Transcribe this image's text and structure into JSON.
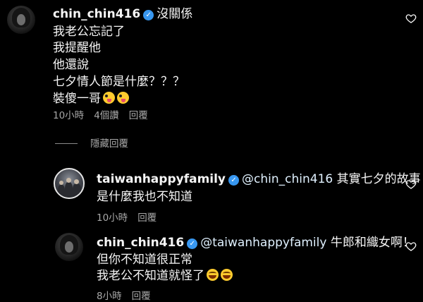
{
  "comments": [
    {
      "username": "chin_chin416",
      "lines": [
        "沒關係",
        "我老公忘記了",
        "我提醒他",
        "他還說",
        "七夕情人節是什麼？？？",
        "裝傻一哥"
      ],
      "emojis": [
        "zany-face-emoji",
        "zany-face-emoji"
      ],
      "time": "10小時",
      "likes": "4個讚",
      "reply": "回覆"
    },
    {
      "username": "taiwanhappyfamily",
      "mention": "@chin_chin416",
      "lines": [
        "其實七夕的故事",
        "是什麼我也不知道"
      ],
      "time": "10小時",
      "reply": "回覆"
    },
    {
      "username": "chin_chin416",
      "mention": "@taiwanhappyfamily",
      "lines": [
        "牛郎和織女啊！",
        "但你不知道很正常",
        "我老公不知道就怪了"
      ],
      "emojis": [
        "laughing-tears-emoji",
        "laughing-tears-emoji"
      ],
      "time": "8小時",
      "reply": "回覆"
    }
  ],
  "hide_replies": "隱藏回覆",
  "icons": {
    "heart": "heart-outline-icon",
    "verified": "verified-badge-icon"
  }
}
